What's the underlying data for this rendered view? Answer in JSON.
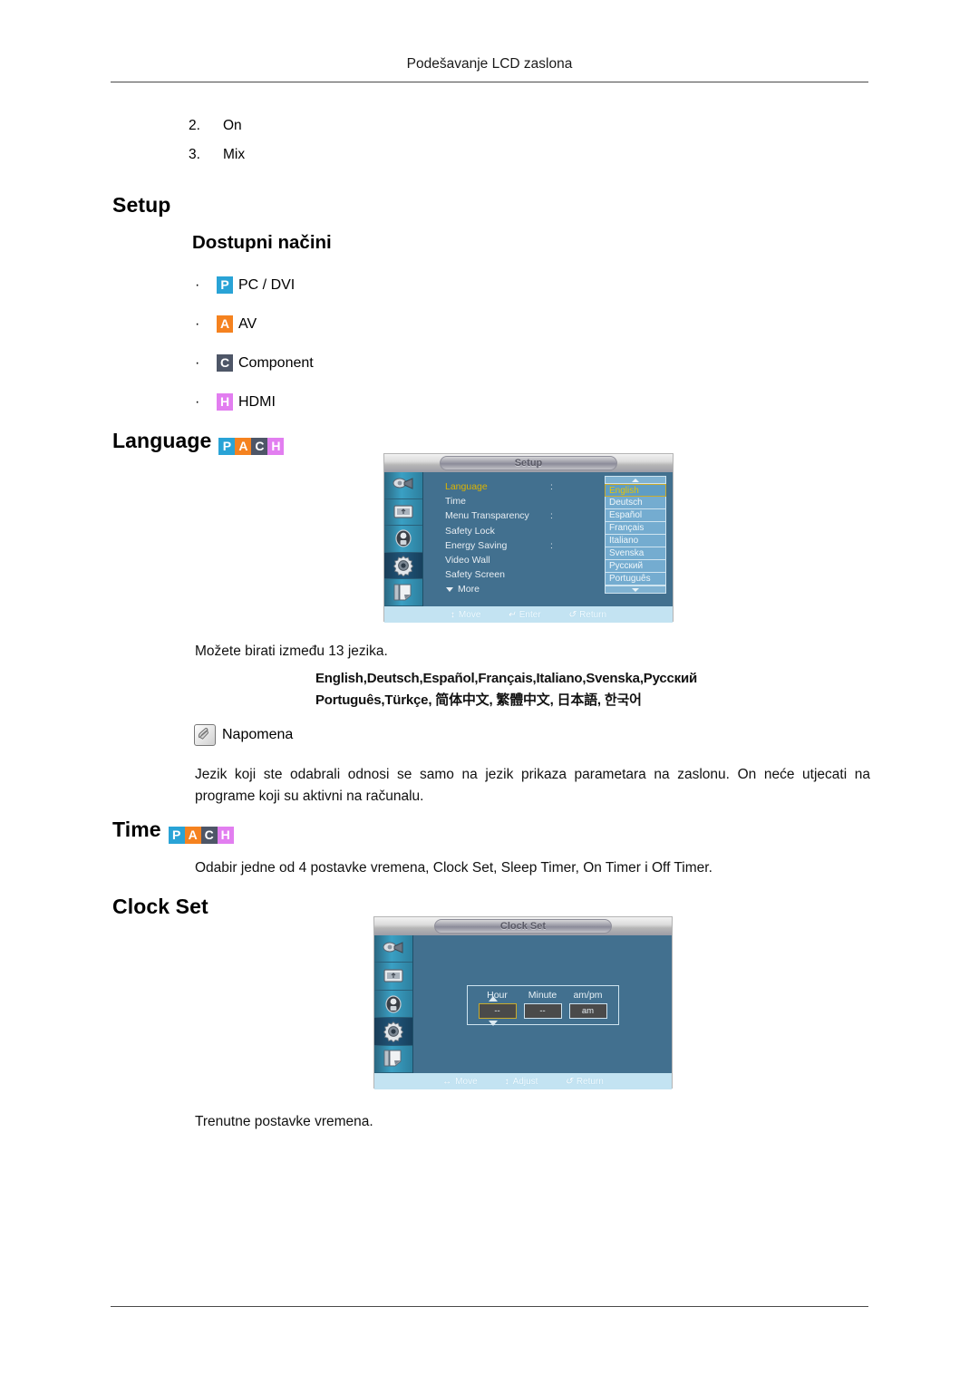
{
  "page": {
    "header": "Podešavanje LCD zaslona"
  },
  "numbered_items": [
    {
      "num": "2.",
      "label": "On"
    },
    {
      "num": "3.",
      "label": "Mix"
    }
  ],
  "sections": {
    "setup_heading": "Setup",
    "available_modes_heading": "Dostupni načini",
    "available_modes": [
      {
        "badge": "P",
        "label": "PC / DVI"
      },
      {
        "badge": "A",
        "label": "AV"
      },
      {
        "badge": "C",
        "label": "Component"
      },
      {
        "badge": "H",
        "label": "HDMI"
      }
    ],
    "language_heading": "Language",
    "language_note": "Možete birati između 13 jezika.",
    "language_list_line1": "English,Deutsch,Español,Français,Italiano,Svenska,Русский",
    "language_list_line2": "Português,Türkçe, 简体中文,  繁體中文, 日本語, 한국어",
    "note_label": "Napomena",
    "note_text": "Jezik koji ste odabrali odnosi se samo na jezik prikaza parametara na zaslonu. On neće utjecati na programe koji su aktivni na računalu.",
    "time_heading": "Time",
    "time_text": "Odabir jedne od 4 postavke vremena, Clock Set, Sleep Timer, On Timer i Off Timer.",
    "clock_set_heading": "Clock Set",
    "clock_set_text": "Trenutne postavke vremena."
  },
  "badge_colors": {
    "P": "#29a3d6",
    "A": "#f5821f",
    "C": "#4e5667",
    "H": "#e27ef0"
  },
  "mode_badges": [
    "P",
    "A",
    "C",
    "H"
  ],
  "osd_language": {
    "title": "Setup",
    "menu_items": [
      "Language",
      "Time",
      "Menu Transparency",
      "Safety Lock",
      "Energy Saving",
      "Video Wall",
      "Safety Screen"
    ],
    "selected_menu_item": "Language",
    "more_label": "More",
    "dropdown_options": [
      "English",
      "Deutsch",
      "Español",
      "Français",
      "Italiano",
      "Svenska",
      "Русский",
      "Português"
    ],
    "selected_option": "English",
    "footer": [
      {
        "glyph": "↕",
        "label": "Move"
      },
      {
        "glyph": "↵",
        "label": "Enter"
      },
      {
        "glyph": "↺",
        "label": "Return"
      }
    ],
    "sidebar_icons": [
      "picture-icon",
      "screen-icon",
      "sound-icon",
      "setup-gear-icon",
      "multi-control-icon"
    ],
    "active_sidebar_index": 3
  },
  "osd_clock": {
    "title": "Clock Set",
    "field_headers": [
      "Hour",
      "Minute",
      "am/pm"
    ],
    "field_values": [
      "--",
      "--",
      "am"
    ],
    "selected_field_index": 0,
    "footer": [
      {
        "glyph": "↔",
        "label": "Move"
      },
      {
        "glyph": "↕",
        "label": "Adjust"
      },
      {
        "glyph": "↺",
        "label": "Return"
      }
    ],
    "sidebar_icons": [
      "picture-icon",
      "screen-icon",
      "sound-icon",
      "setup-gear-icon",
      "multi-control-icon"
    ],
    "active_sidebar_index": 3
  }
}
